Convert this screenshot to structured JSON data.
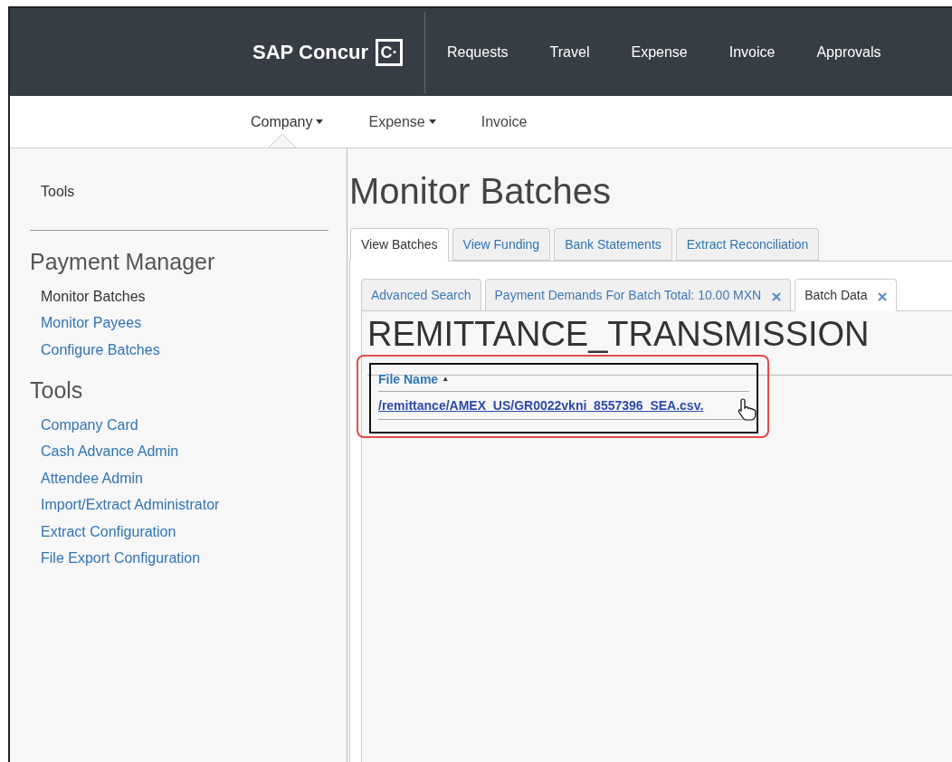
{
  "header": {
    "logo": "SAP Concur",
    "logo_mark": "C·",
    "nav": [
      {
        "label": "Requests"
      },
      {
        "label": "Travel"
      },
      {
        "label": "Expense"
      },
      {
        "label": "Invoice"
      },
      {
        "label": "Approvals"
      }
    ]
  },
  "subnav": [
    {
      "label": "Company",
      "dropdown": true,
      "selected": true
    },
    {
      "label": "Expense",
      "dropdown": true,
      "selected": false
    },
    {
      "label": "Invoice",
      "dropdown": false,
      "selected": false
    }
  ],
  "sidebar": {
    "title": "Tools",
    "sections": [
      {
        "heading": "Payment Manager",
        "items": [
          {
            "label": "Monitor Batches",
            "selected": true
          },
          {
            "label": "Monitor Payees",
            "selected": false
          },
          {
            "label": "Configure Batches",
            "selected": false
          }
        ]
      },
      {
        "heading": "Tools",
        "items": [
          {
            "label": "Company Card",
            "selected": false
          },
          {
            "label": "Cash Advance Admin",
            "selected": false
          },
          {
            "label": "Attendee Admin",
            "selected": false
          },
          {
            "label": "Import/Extract Administrator",
            "selected": false
          },
          {
            "label": "Extract Configuration",
            "selected": false
          },
          {
            "label": "File Export Configuration",
            "selected": false
          }
        ]
      }
    ]
  },
  "page_title": "Monitor Batches",
  "tabs": [
    {
      "label": "View Batches",
      "selected": true
    },
    {
      "label": "View Funding",
      "selected": false
    },
    {
      "label": "Bank Statements",
      "selected": false
    },
    {
      "label": "Extract Reconciliation",
      "selected": false
    }
  ],
  "inner_tabs": [
    {
      "label": "Advanced Search",
      "selected": false,
      "closable": false
    },
    {
      "label": "Payment Demands For Batch Total: 10.00 MXN",
      "selected": false,
      "closable": true
    },
    {
      "label": "Batch Data",
      "selected": true,
      "closable": true
    }
  ],
  "batch_title": "REMITTANCE_TRANSMISSION",
  "table": {
    "column": "File Name",
    "sort": "▲",
    "rows": [
      {
        "file": "/remittance/AMEX_US/GR0022vkni_8557396_SEA.csv."
      }
    ]
  }
}
